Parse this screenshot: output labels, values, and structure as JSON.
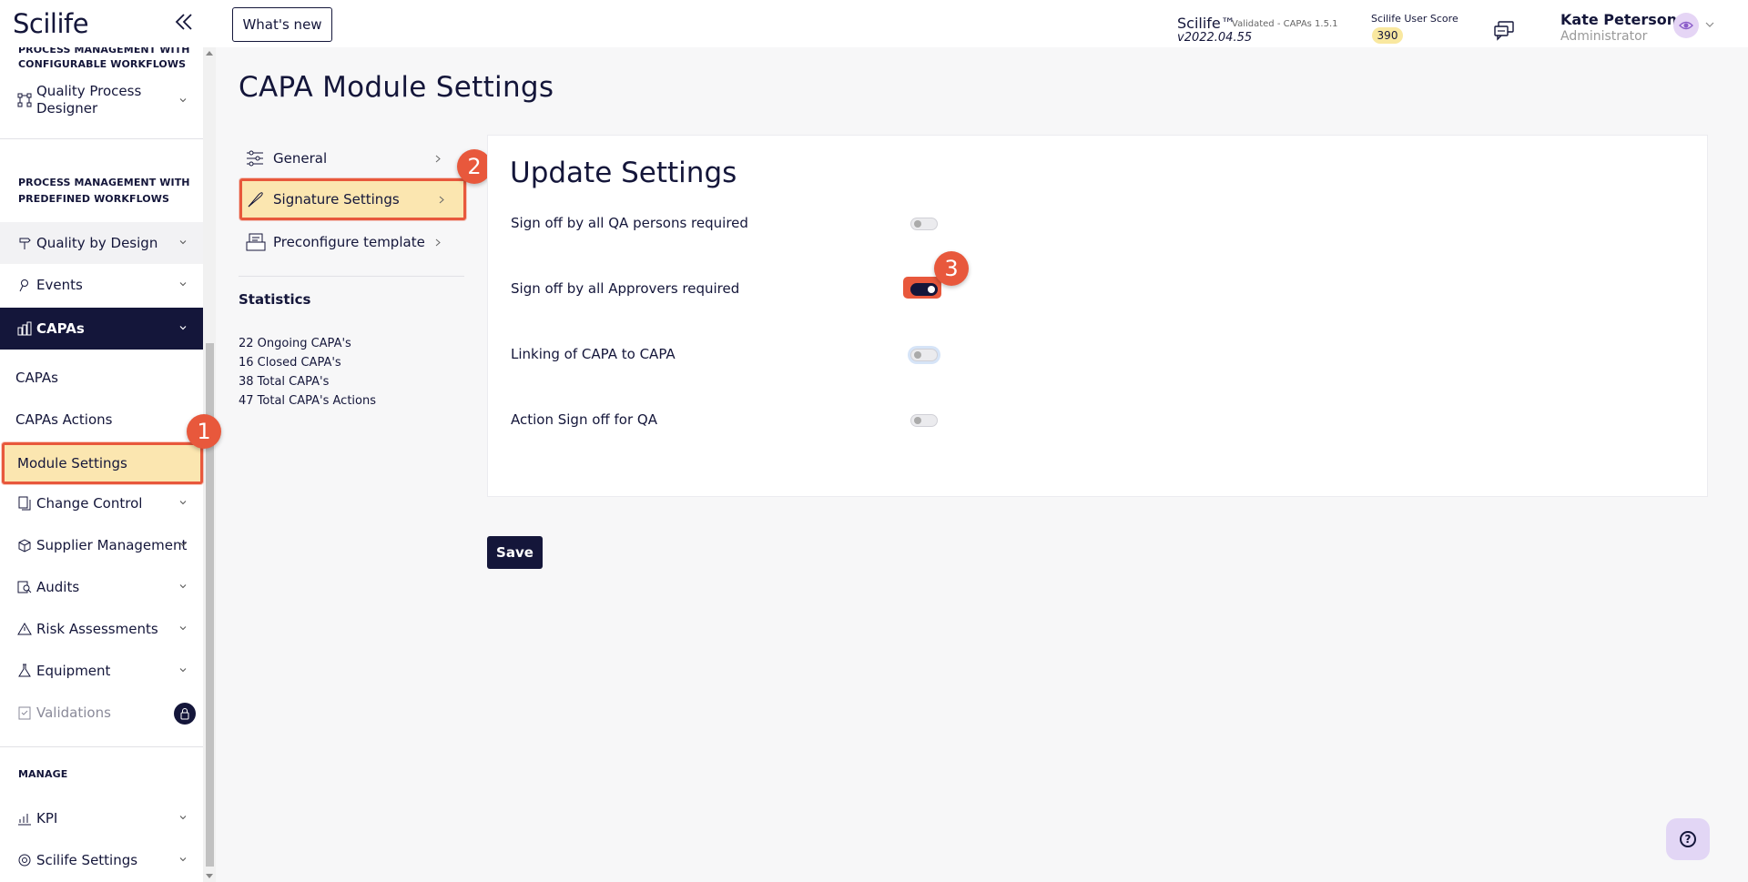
{
  "app": {
    "logo_text": "Scilife"
  },
  "topbar": {
    "whats_new_label": "What's new",
    "version_name": "Scilife™",
    "version_sub": "Validated - CAPAs 1.5.1",
    "version_number": "v2022.04.55",
    "score_label": "Scilife User Score",
    "score_value": "390",
    "user_name": "Kate Peterson",
    "user_role": "Administrator"
  },
  "sidebar": {
    "section_cut": "PROCESS MANAGEMENT WITH",
    "section_configurable": "CONFIGURABLE WORKFLOWS",
    "quality_process_designer_line1": "Quality Process",
    "quality_process_designer_line2": "Designer",
    "section_predefined_1": "PROCESS MANAGEMENT WITH",
    "section_predefined_2": "PREDEFINED WORKFLOWS",
    "quality_by_design": "Quality by Design",
    "events": "Events",
    "capas": "CAPAs",
    "sub_capas": "CAPAs",
    "sub_capas_actions": "CAPAs Actions",
    "sub_module_settings": "Module Settings",
    "change_control": "Change Control",
    "supplier_management": "Supplier Management",
    "audits": "Audits",
    "risk_assessments": "Risk Assessments",
    "equipment": "Equipment",
    "validations": "Validations",
    "section_manage": "MANAGE",
    "kpi": "KPI",
    "scilife_settings": "Scilife Settings"
  },
  "main": {
    "page_title": "CAPA Module Settings",
    "menu": {
      "general": "General",
      "signature_settings": "Signature Settings",
      "preconfigure_template": "Preconfigure template"
    },
    "statistics_title": "Statistics",
    "stats": [
      "22 Ongoing CAPA's",
      "16 Closed CAPA's",
      "38 Total CAPA's",
      "47 Total CAPA's Actions"
    ],
    "panel_title": "Update Settings",
    "settings": [
      {
        "label": "Sign off by all QA persons required",
        "enabled": false
      },
      {
        "label": "Sign off by all Approvers required",
        "enabled": true
      },
      {
        "label": "Linking of CAPA to CAPA",
        "enabled": false
      },
      {
        "label": "Action Sign off for QA",
        "enabled": false
      }
    ],
    "save_label": "Save"
  },
  "annotations": {
    "step1": "1",
    "step2": "2",
    "step3": "3"
  },
  "colors": {
    "navy": "#14163a",
    "highlight": "#fbe6b0",
    "annotation": "#e8583c",
    "score_badge": "#f9e8a0"
  }
}
